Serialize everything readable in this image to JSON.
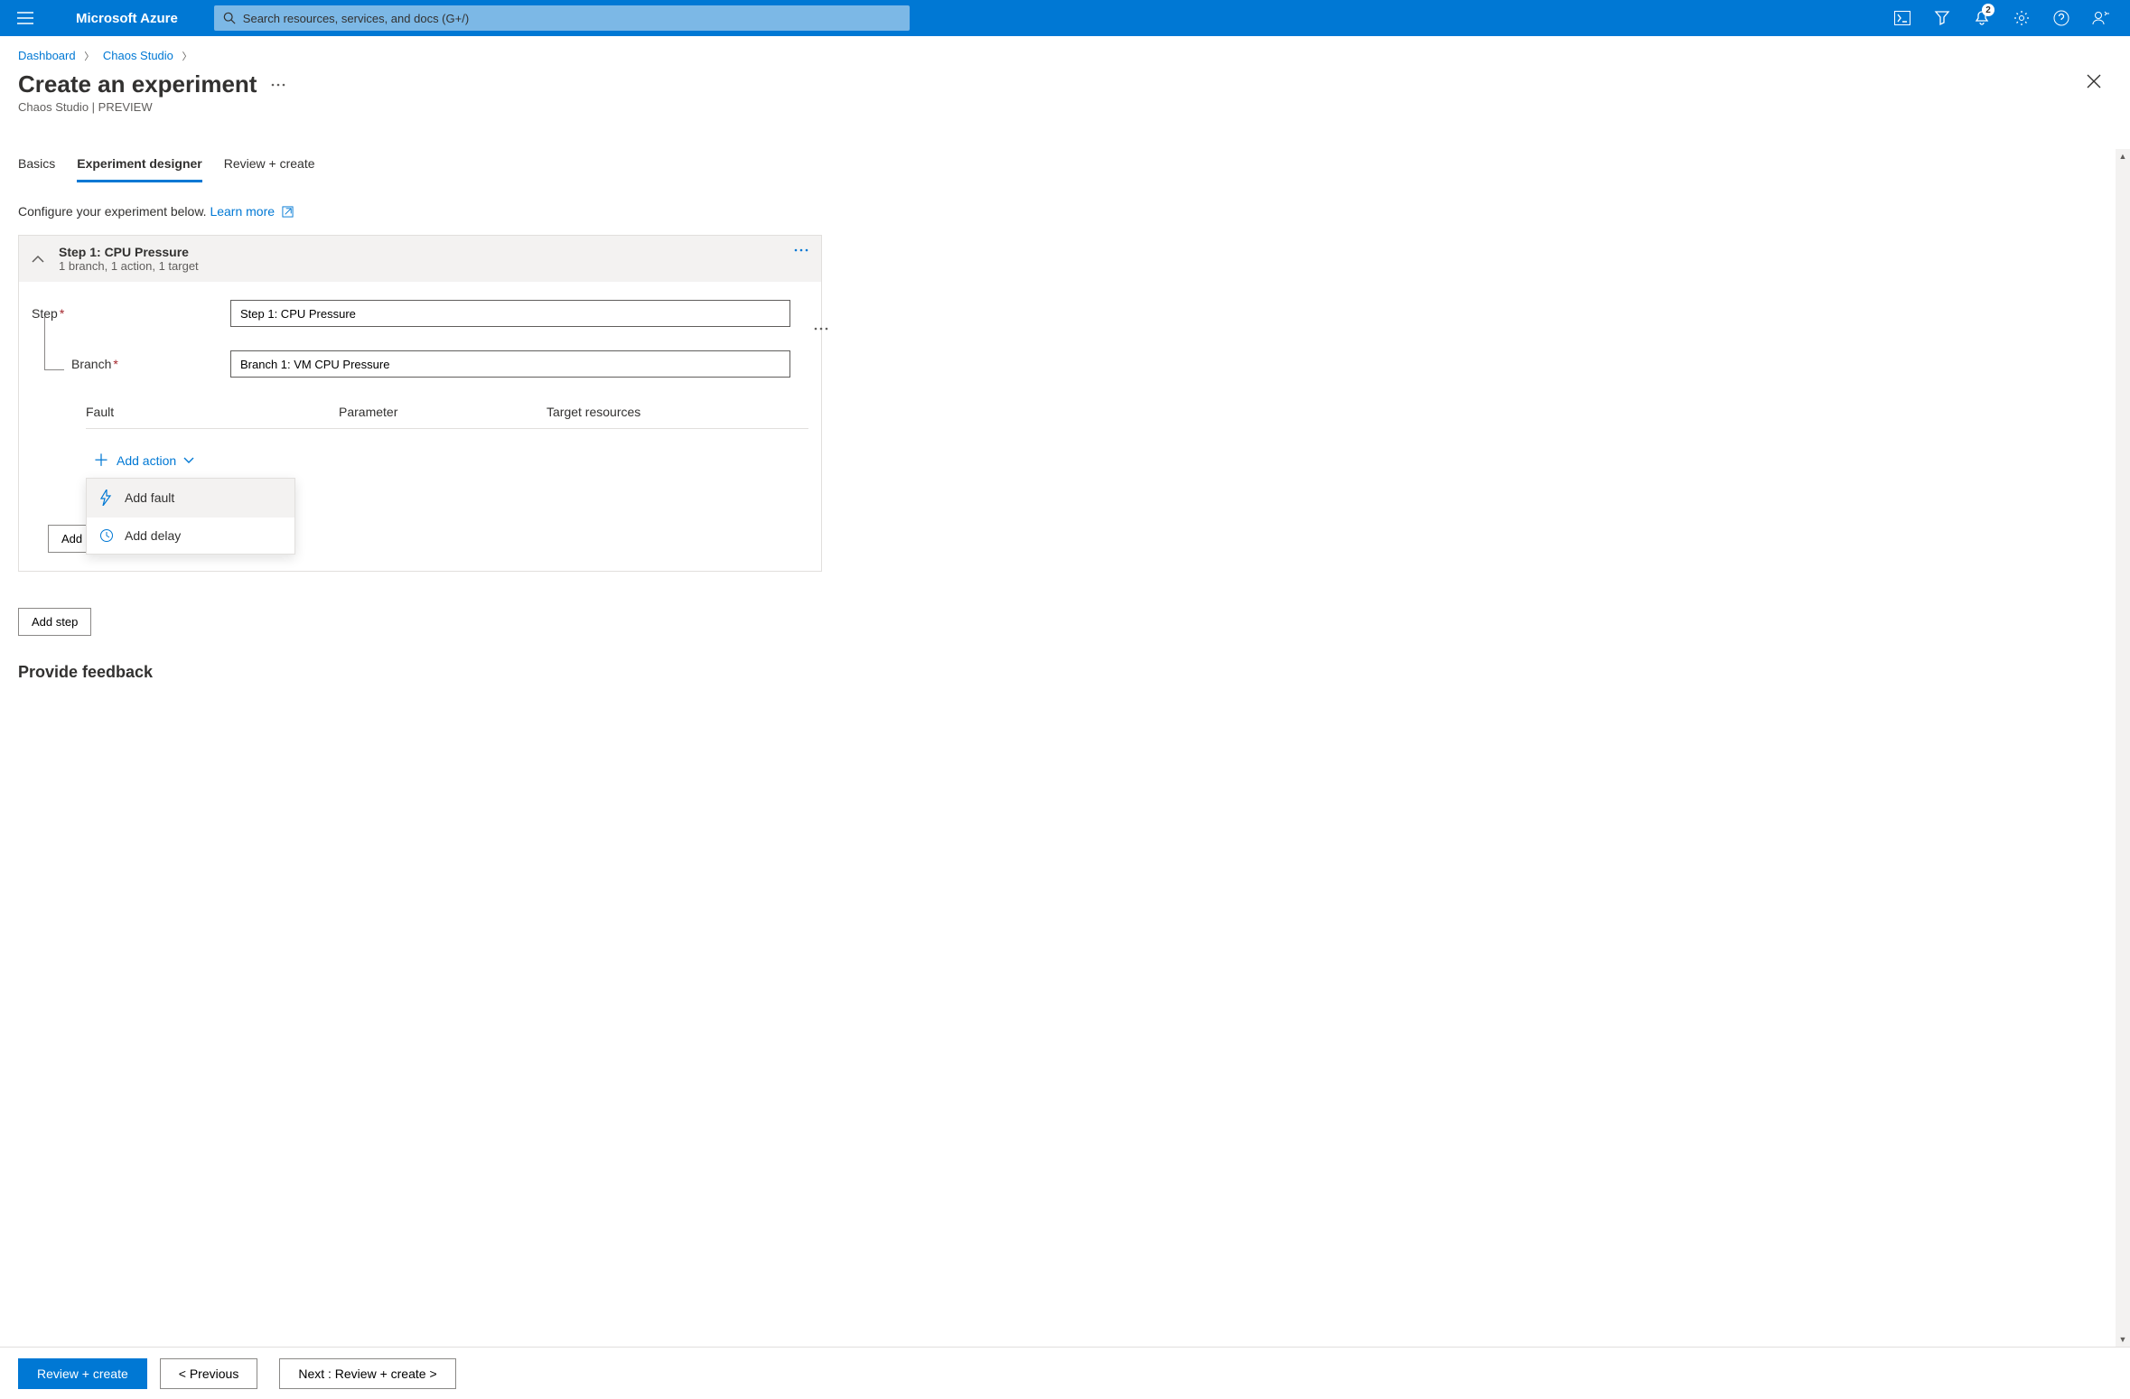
{
  "header": {
    "brand": "Microsoft Azure",
    "search_placeholder": "Search resources, services, and docs (G+/)",
    "notification_count": "2"
  },
  "breadcrumb": {
    "items": [
      "Dashboard",
      "Chaos Studio"
    ]
  },
  "page": {
    "title": "Create an experiment",
    "subtitle": "Chaos Studio | PREVIEW"
  },
  "tabs": [
    "Basics",
    "Experiment designer",
    "Review + create"
  ],
  "active_tab": 1,
  "intro": {
    "text": "Configure your experiment below.",
    "learn_more": "Learn more"
  },
  "step_card": {
    "title": "Step 1: CPU Pressure",
    "summary": "1 branch, 1 action, 1 target",
    "step_label": "Step",
    "step_value": "Step 1: CPU Pressure",
    "branch_label": "Branch",
    "branch_value": "Branch 1: VM CPU Pressure",
    "columns": [
      "Fault",
      "Parameter",
      "Target resources"
    ],
    "add_action": "Add action",
    "dropdown": {
      "add_fault": "Add fault",
      "add_delay": "Add delay"
    },
    "add_branch": "Add",
    "add_step": "Add step"
  },
  "feedback_heading": "Provide feedback",
  "footer": {
    "review": "Review + create",
    "previous": "< Previous",
    "next": "Next : Review + create >"
  }
}
